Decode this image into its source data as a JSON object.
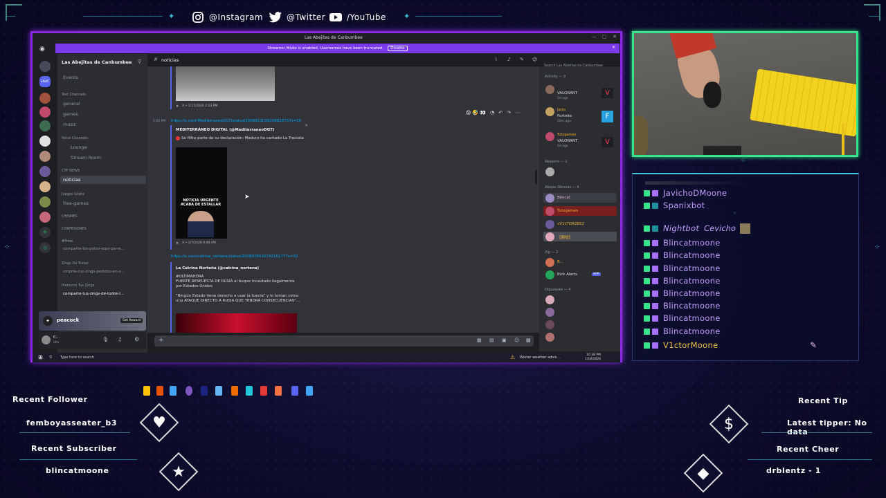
{
  "socials": {
    "instagram": "@Instagram",
    "twitter": "@Twitter",
    "youtube": "/YouTube"
  },
  "discord": {
    "window_title": "Las Abejitas de Canbumbee",
    "banner_text": "Streamer Mode is enabled. Usernames have been truncated.",
    "banner_button": "Disable",
    "server_name": "Las Abejitas de Canbumbee",
    "channel_title": "noticias",
    "search_placeholder": "Search Las Abejitas de Canbumbee",
    "events": "Events",
    "categories": {
      "text": "Text Channels",
      "voice": "Voice Channels",
      "cpp": "CPP NEWS",
      "juegos": "Juegos Gratis",
      "chismes": "CHISMES",
      "confesiones": "CONFESIONES",
      "pitos": "#Pitos",
      "zings": "Zings De Troleo",
      "prenuma": "Prenuma Tus Zings"
    },
    "channels": [
      "general",
      "games",
      "music",
      "Lounge",
      "Stream Room",
      "noticias",
      "free-games",
      "comparte-los-potos-aqui-pa-re...",
      "cmprte-tus-zings-pedidos-en-s...",
      "comparte-tus-zings-de-todos-l..."
    ],
    "messages": {
      "time1": "X • 1/17/2026 2:03 PM",
      "link1": "https://x.com/MediterraneoDGT/status/2008913038208828757s=20",
      "stamp1": "5:26 PM",
      "embed1_author": "MEDITERRÁNEO DIGITAL (@MediterraneoDGT)",
      "embed1_text": "Se filtra parte de su declaración: Maduro ha cantado La Traviata",
      "video_caption": "NOTICIA URGENTE ACABA DE ESTALLAR",
      "time2": "X • 1/7/2026 9:46 AM",
      "link2": "https://x.com/catrina_nortena/status/2008976610742161777s=20",
      "embed2_author": "La Catrina Norteña (@catrina_nortena)",
      "embed2_line1": "#ULTIMAHORA",
      "embed2_line2": "FUERTE RESPUESTA DE RUSIA al buque incautado ilegalmente por Estados Unidos",
      "embed2_line3": "\"Ningún Estado tiene derecho a usar la fuerza\" y lo toman como una ATAQUE DIRECTO A RUSIA QUE TENDRÁ CONSECUENCIAS\"..."
    },
    "members": {
      "activity": "Activity — 9",
      "act1_game": "VALORANT",
      "act1_time": "1d ago",
      "act2_name": "Jairo",
      "act2_game": "Fortnite",
      "act2_time": "20m ago",
      "act3_name": "Tutogames",
      "act3_game": "VALORANT",
      "act3_time": "1d ago",
      "abejorro": "Abejorro — 1",
      "obreras": "Abejas Obreras — 4",
      "o1": "Blincat",
      "o2": "Tutogames",
      "o3": "vV1cTOR2852",
      "o4": "【腕桜】",
      "vip": "Vip — 2",
      "v1": "B...",
      "v2": "Kick Alerts",
      "app": "APP",
      "olguzanes": "Olguzanes — 4"
    },
    "peacock": "peacock",
    "peacock_btn": "Get Reward",
    "user": "C...",
    "user_status": "Idle",
    "taskbar_search": "Type here to search",
    "weather": "Winter weather advis...",
    "clock": "10:38 PM",
    "date": "1/18/2026"
  },
  "chat": {
    "names": [
      "JavichoDMoone",
      "Spanixbot",
      "Nightbot",
      "Blincatmoone",
      "Blincatmoone",
      "Blincatmoone",
      "Blincatmoone",
      "Blincatmoone",
      "Blincatmoone",
      "Blincatmoone",
      "Blincatmoone",
      "V1ctorMoone"
    ],
    "nightbot_msg": "Cevicho"
  },
  "alerts": {
    "recent_follower_label": "Recent Follower",
    "recent_follower": "femboyasseater_b3",
    "recent_subscriber_label": "Recent Subscriber",
    "recent_subscriber": "blincatmoone",
    "recent_tip_label": "Recent Tip",
    "recent_tip": "Latest tipper: No data",
    "recent_cheer_label": "Recent Cheer",
    "recent_cheer": "drblentz - 1"
  }
}
